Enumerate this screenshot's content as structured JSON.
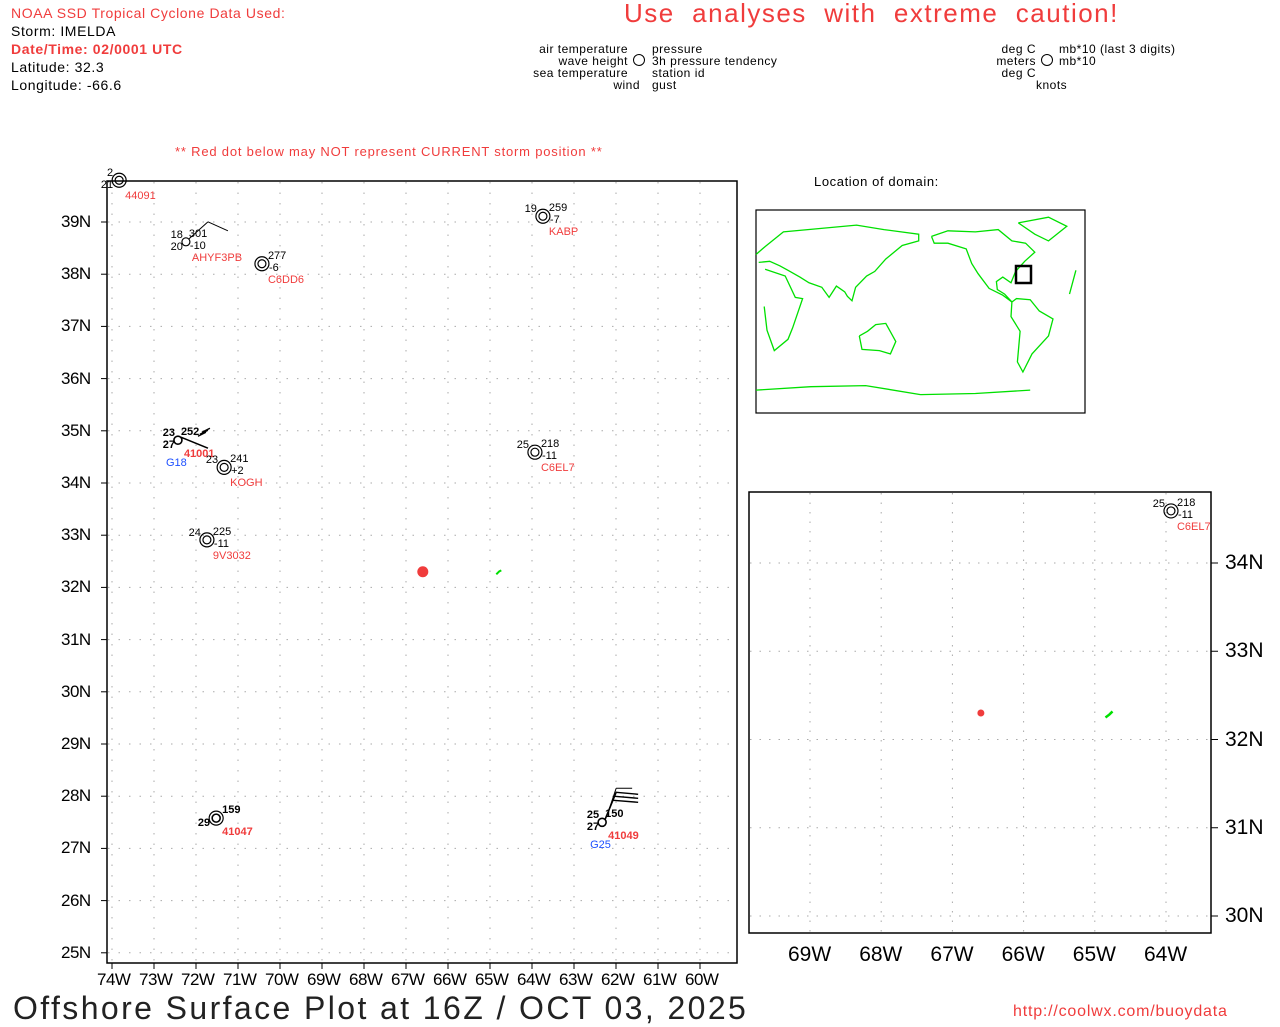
{
  "header": {
    "source": "NOAA SSD Tropical Cyclone Data Used:",
    "storm": "Storm: IMELDA",
    "datetime": "Date/Time: 02/0001 UTC",
    "latitude": "Latitude: 32.3",
    "longitude": "Longitude: -66.6",
    "caution": "Use  analyses  with  extreme  caution!",
    "red_dot_note": "** Red dot below may NOT represent CURRENT storm position **"
  },
  "legend": {
    "air": "air temperature",
    "wave": "wave height",
    "sea": "sea temperature",
    "wind": "wind",
    "pressure": "pressure",
    "tendency": "3h pressure tendency",
    "station": "station id",
    "gust": "gust",
    "u_air": "deg C",
    "u_wave": "meters",
    "u_sea": "deg C",
    "u_wind": "knots",
    "u_pressure": "mb*10 (last 3 digits)",
    "u_tendency": "mb*10"
  },
  "domain_label": "Location of domain:",
  "storm_position": {
    "lat": 32.3,
    "lon": -66.6,
    "color": "#f03c3c"
  },
  "main_map": {
    "lon_ticks": [
      "74W",
      "73W",
      "72W",
      "71W",
      "70W",
      "69W",
      "68W",
      "67W",
      "66W",
      "65W",
      "64W",
      "63W",
      "62W",
      "61W",
      "60W"
    ],
    "lat_ticks": [
      "39N",
      "38N",
      "37N",
      "36N",
      "35N",
      "34N",
      "33N",
      "32N",
      "31N",
      "30N",
      "29N",
      "28N",
      "27N",
      "26N",
      "25N"
    ]
  },
  "inset_map": {
    "lon_ticks": [
      "69W",
      "68W",
      "67W",
      "66W",
      "65W",
      "64W"
    ],
    "lat_ticks": [
      "34N",
      "33N",
      "32N",
      "31N",
      "30N"
    ]
  },
  "stations": [
    {
      "id": "44091",
      "lat": 39.8,
      "lon": -73.83,
      "air": "2",
      "sea": "21",
      "pres": "",
      "tend": "",
      "gust": "",
      "buoy": false,
      "double": true
    },
    {
      "id": "AHYF3PB",
      "lat": 38.62,
      "lon": -72.24,
      "air": "18",
      "sea": "20",
      "pres": "301",
      "tend": "-10",
      "gust": "",
      "buoy": false,
      "double": false,
      "barb": true
    },
    {
      "id": "C6DD6",
      "lat": 38.2,
      "lon": -70.43,
      "air": "",
      "sea": "",
      "pres": "277",
      "tend": "-6",
      "gust": "",
      "buoy": false,
      "double": true
    },
    {
      "id": "KABP",
      "lat": 39.11,
      "lon": -63.74,
      "air": "19",
      "sea": "",
      "pres": "259",
      "tend": "-7",
      "gust": "",
      "buoy": false,
      "double": true
    },
    {
      "id": "41001",
      "lat": 34.82,
      "lon": -72.43,
      "air": "23",
      "sea": "27",
      "pres": "252",
      "tend": "",
      "gust": "G18",
      "buoy": true,
      "double": false,
      "barb": true
    },
    {
      "id": "KOGH",
      "lat": 34.3,
      "lon": -71.33,
      "air": "23",
      "sea": "",
      "pres": "241",
      "tend": "+2",
      "gust": "",
      "buoy": false,
      "double": true
    },
    {
      "id": "C6EL7",
      "lat": 34.59,
      "lon": -63.93,
      "air": "25",
      "sea": "",
      "pres": "218",
      "tend": "-11",
      "gust": "",
      "buoy": false,
      "double": true,
      "inset": true
    },
    {
      "id": "9V3032",
      "lat": 32.91,
      "lon": -71.74,
      "air": "24",
      "sea": "",
      "pres": "225",
      "tend": "-11",
      "gust": "",
      "buoy": false,
      "double": true
    },
    {
      "id": "41047",
      "lat": 27.58,
      "lon": -71.52,
      "air": "",
      "sea": "29",
      "pres": "159",
      "tend": "",
      "gust": "",
      "buoy": true,
      "double": true
    },
    {
      "id": "41049",
      "lat": 27.5,
      "lon": -62.33,
      "air": "25",
      "sea": "27",
      "pres": "150",
      "tend": "",
      "gust": "G25",
      "buoy": true,
      "double": false,
      "barb": true
    }
  ],
  "footer": {
    "title": "Offshore Surface Plot at 16Z / OCT 03, 2025",
    "url": "http://coolwx.com/buoydata"
  },
  "colors": {
    "red": "#f03c3c",
    "blue": "#1e50ff",
    "land": "#00e000",
    "grid": "#aaaaaa"
  }
}
